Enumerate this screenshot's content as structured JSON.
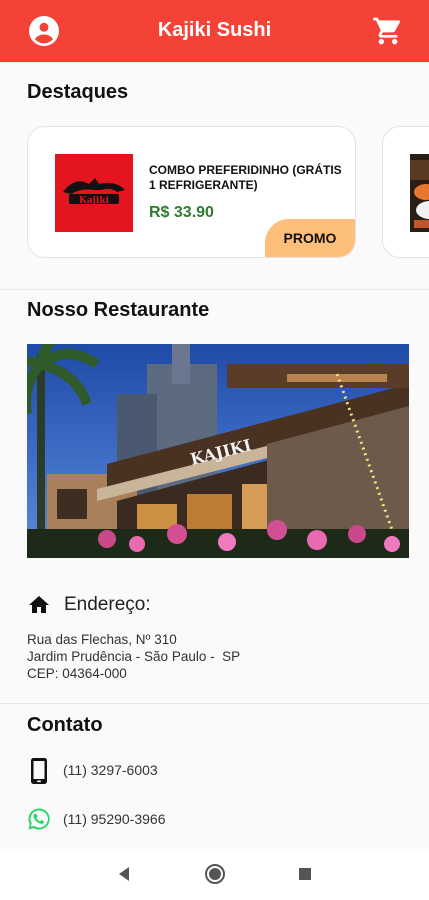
{
  "appbar": {
    "title": "Kajiki Sushi",
    "left_icon": "account-circle-icon",
    "right_icon": "shopping-cart-icon",
    "color": "#f44336"
  },
  "highlights": {
    "title": "Destaques",
    "items": [
      {
        "name": "COMBO PREFERIDINHO (GRÁTIS 1 REFRIGERANTE)",
        "price": "R$ 33.90",
        "badge": "PROMO",
        "image": "kajiki-logo",
        "logo_text": "Kajiki"
      }
    ]
  },
  "restaurant": {
    "title": "Nosso Restaurante",
    "photo_sign": "KAJIKI"
  },
  "address": {
    "icon": "home-icon",
    "label": "Endereço:",
    "lines": [
      "Rua das Flechas, Nº 310",
      "Jardim Prudência - São Paulo -  SP",
      "CEP: 04364-000"
    ]
  },
  "contact": {
    "title": "Contato",
    "phone": "(11) 3297-6003",
    "whatsapp": "(11) 95290-3966"
  },
  "colors": {
    "price": "#2e7d32",
    "promo_badge": "#fdbf7a",
    "whatsapp": "#25d366"
  },
  "system_nav": {
    "buttons": [
      "back-icon",
      "home-circle-icon",
      "recents-icon"
    ]
  }
}
